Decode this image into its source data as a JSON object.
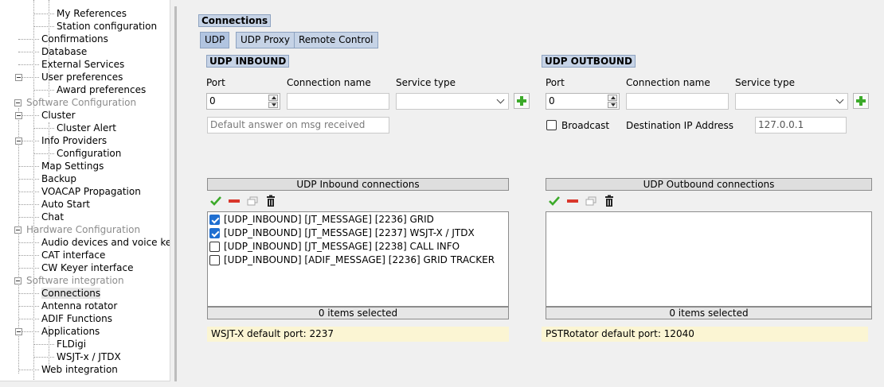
{
  "tree": [
    {
      "label": "My References",
      "level": 2,
      "disabled": false
    },
    {
      "label": "Station configuration",
      "level": 2,
      "disabled": false
    },
    {
      "label": "Confirmations",
      "level": 1,
      "disabled": false
    },
    {
      "label": "Database",
      "level": 1,
      "disabled": false
    },
    {
      "label": "External Services",
      "level": 1,
      "disabled": false
    },
    {
      "label": "User preferences",
      "level": 1,
      "disabled": false,
      "expanded": true
    },
    {
      "label": "Award preferences",
      "level": 2,
      "disabled": false
    },
    {
      "label": "Software Configuration",
      "level": 0,
      "disabled": true,
      "expanded": true
    },
    {
      "label": "Cluster",
      "level": 1,
      "disabled": false,
      "expanded": true
    },
    {
      "label": "Cluster Alert",
      "level": 2,
      "disabled": false
    },
    {
      "label": "Info Providers",
      "level": 1,
      "disabled": false,
      "expanded": true
    },
    {
      "label": "Configuration",
      "level": 2,
      "disabled": false
    },
    {
      "label": "Map Settings",
      "level": 1,
      "disabled": false
    },
    {
      "label": "Backup",
      "level": 1,
      "disabled": false
    },
    {
      "label": "VOACAP Propagation",
      "level": 1,
      "disabled": false
    },
    {
      "label": "Auto Start",
      "level": 1,
      "disabled": false
    },
    {
      "label": "Chat",
      "level": 1,
      "disabled": false
    },
    {
      "label": "Hardware Configuration",
      "level": 0,
      "disabled": true,
      "expanded": true
    },
    {
      "label": "Audio devices and voice keye",
      "level": 1,
      "disabled": false
    },
    {
      "label": "CAT interface",
      "level": 1,
      "disabled": false
    },
    {
      "label": "CW Keyer interface",
      "level": 1,
      "disabled": false
    },
    {
      "label": "Software integration",
      "level": 0,
      "disabled": true,
      "expanded": true
    },
    {
      "label": "Connections",
      "level": 1,
      "disabled": false,
      "selected": true
    },
    {
      "label": "Antenna rotator",
      "level": 1,
      "disabled": false
    },
    {
      "label": "ADIF Functions",
      "level": 1,
      "disabled": false
    },
    {
      "label": "Applications",
      "level": 1,
      "disabled": false,
      "expanded": true
    },
    {
      "label": "FLDigi",
      "level": 2,
      "disabled": false
    },
    {
      "label": "WSJT-x / JTDX",
      "level": 2,
      "disabled": false
    },
    {
      "label": "Web integration",
      "level": 1,
      "disabled": false
    }
  ],
  "main": {
    "title": "Connections",
    "tabs": [
      {
        "label": "UDP",
        "active": true
      },
      {
        "label": "UDP Proxy",
        "active": false
      },
      {
        "label": "Remote Control",
        "active": false
      }
    ]
  },
  "inbound": {
    "section_title": "UDP INBOUND",
    "port_label": "Port",
    "connection_name_label": "Connection name",
    "service_type_label": "Service type",
    "port_value": "0",
    "connection_name_value": "",
    "service_type_value": "",
    "default_answer_placeholder": "Default answer on msg received",
    "list_header": "UDP Inbound connections",
    "items": [
      {
        "text": "[UDP_INBOUND] [JT_MESSAGE] [2236] GRID",
        "checked": true
      },
      {
        "text": "[UDP_INBOUND] [JT_MESSAGE] [2237] WSJT-X / JTDX",
        "checked": true
      },
      {
        "text": "[UDP_INBOUND] [JT_MESSAGE] [2238] CALL INFO",
        "checked": false
      },
      {
        "text": "[UDP_INBOUND] [ADIF_MESSAGE] [2236] GRID TRACKER",
        "checked": false
      }
    ],
    "footer": "0 items selected",
    "hint": "WSJT-X default port: 2237"
  },
  "outbound": {
    "section_title": "UDP OUTBOUND",
    "port_label": "Port",
    "connection_name_label": "Connection name",
    "service_type_label": "Service type",
    "port_value": "0",
    "connection_name_value": "",
    "service_type_value": "",
    "broadcast_label": "Broadcast",
    "broadcast_checked": false,
    "dest_ip_label": "Destination IP Address",
    "dest_ip_value": "127.0.0.1",
    "list_header": "UDP Outbound connections",
    "items": [],
    "footer": "0 items selected",
    "hint": "PSTRotator default port: 12040"
  },
  "icons": [
    "check-icon",
    "minus-icon",
    "copy-icon",
    "trash-icon",
    "plus-icon"
  ],
  "colors": {
    "title_bg": "#c6d3e6",
    "hint_bg": "#fbf5d3",
    "checkbox_checked": "#1f6fd1",
    "plus_green": "#3caa2a",
    "minus_red": "#d9362b"
  }
}
